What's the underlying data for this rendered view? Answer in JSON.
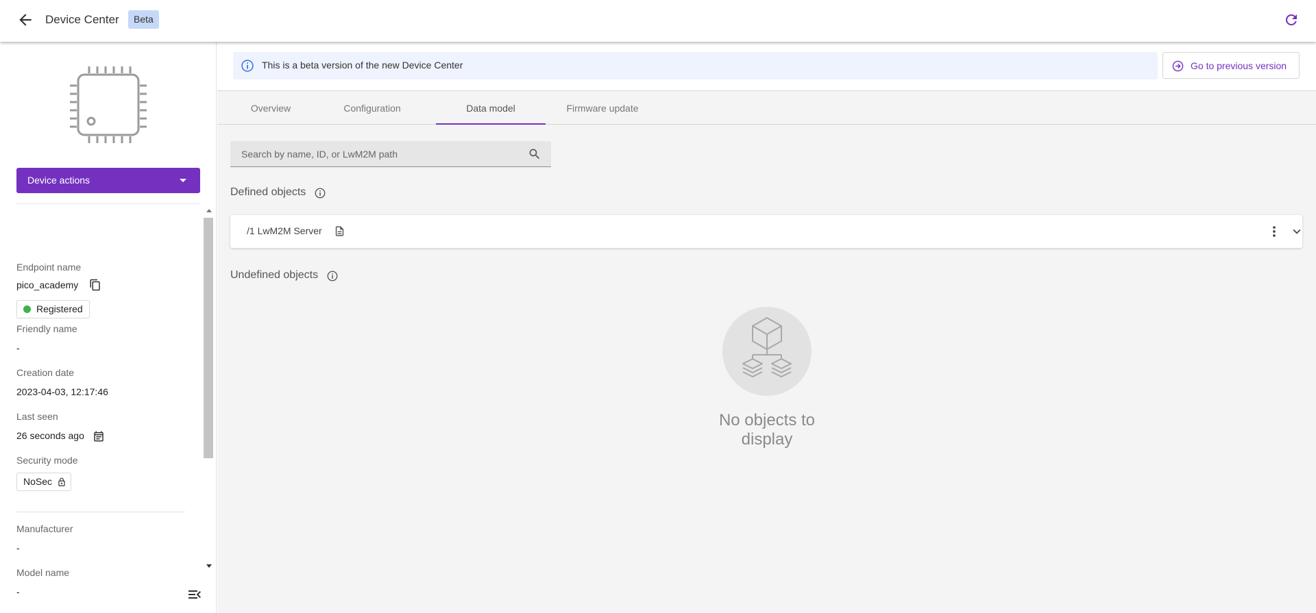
{
  "header": {
    "title": "Device Center",
    "badge": "Beta"
  },
  "sidebar": {
    "device_actions_label": "Device actions",
    "fields": {
      "endpoint_label": "Endpoint name",
      "endpoint_value": "pico_academy",
      "status": "Registered",
      "friendly_label": "Friendly name",
      "friendly_value": "-",
      "creation_label": "Creation date",
      "creation_value": "2023-04-03, 12:17:46",
      "last_seen_label": "Last seen",
      "last_seen_value": "26 seconds ago",
      "security_label": "Security mode",
      "security_value": "NoSec",
      "manufacturer_label": "Manufacturer",
      "manufacturer_value": "-",
      "model_label": "Model name",
      "model_value": "-"
    }
  },
  "banner": {
    "text": "This is a beta version of the new Device Center",
    "prev_version_label": "Go to previous version"
  },
  "tabs": [
    {
      "label": "Overview"
    },
    {
      "label": "Configuration"
    },
    {
      "label": "Data model",
      "active": true
    },
    {
      "label": "Firmware update"
    }
  ],
  "search": {
    "placeholder": "Search by name, ID, or LwM2M path"
  },
  "defined_objects": {
    "title": "Defined objects",
    "items": [
      {
        "label": "/1 LwM2M Server"
      }
    ]
  },
  "undefined_objects": {
    "title": "Undefined objects",
    "empty_text": "No objects to display"
  },
  "colors": {
    "accent": "#7431bf",
    "status_registered": "#3cb44b",
    "banner_bg": "#eef3fd",
    "badge_bg": "#c6d8f7",
    "info_blue": "#2f6fdf"
  },
  "icons": {
    "back": "arrow-left-icon",
    "refresh": "refresh-icon",
    "device": "chip-icon",
    "copy": "copy-icon",
    "calendar": "calendar-icon",
    "lock": "lock-icon",
    "info": "info-icon",
    "search": "search-icon",
    "document": "document-icon",
    "more": "more-vertical-icon",
    "chevron": "chevron-down-icon",
    "collapse": "collapse-menu-icon",
    "empty": "objects-hierarchy-icon"
  }
}
